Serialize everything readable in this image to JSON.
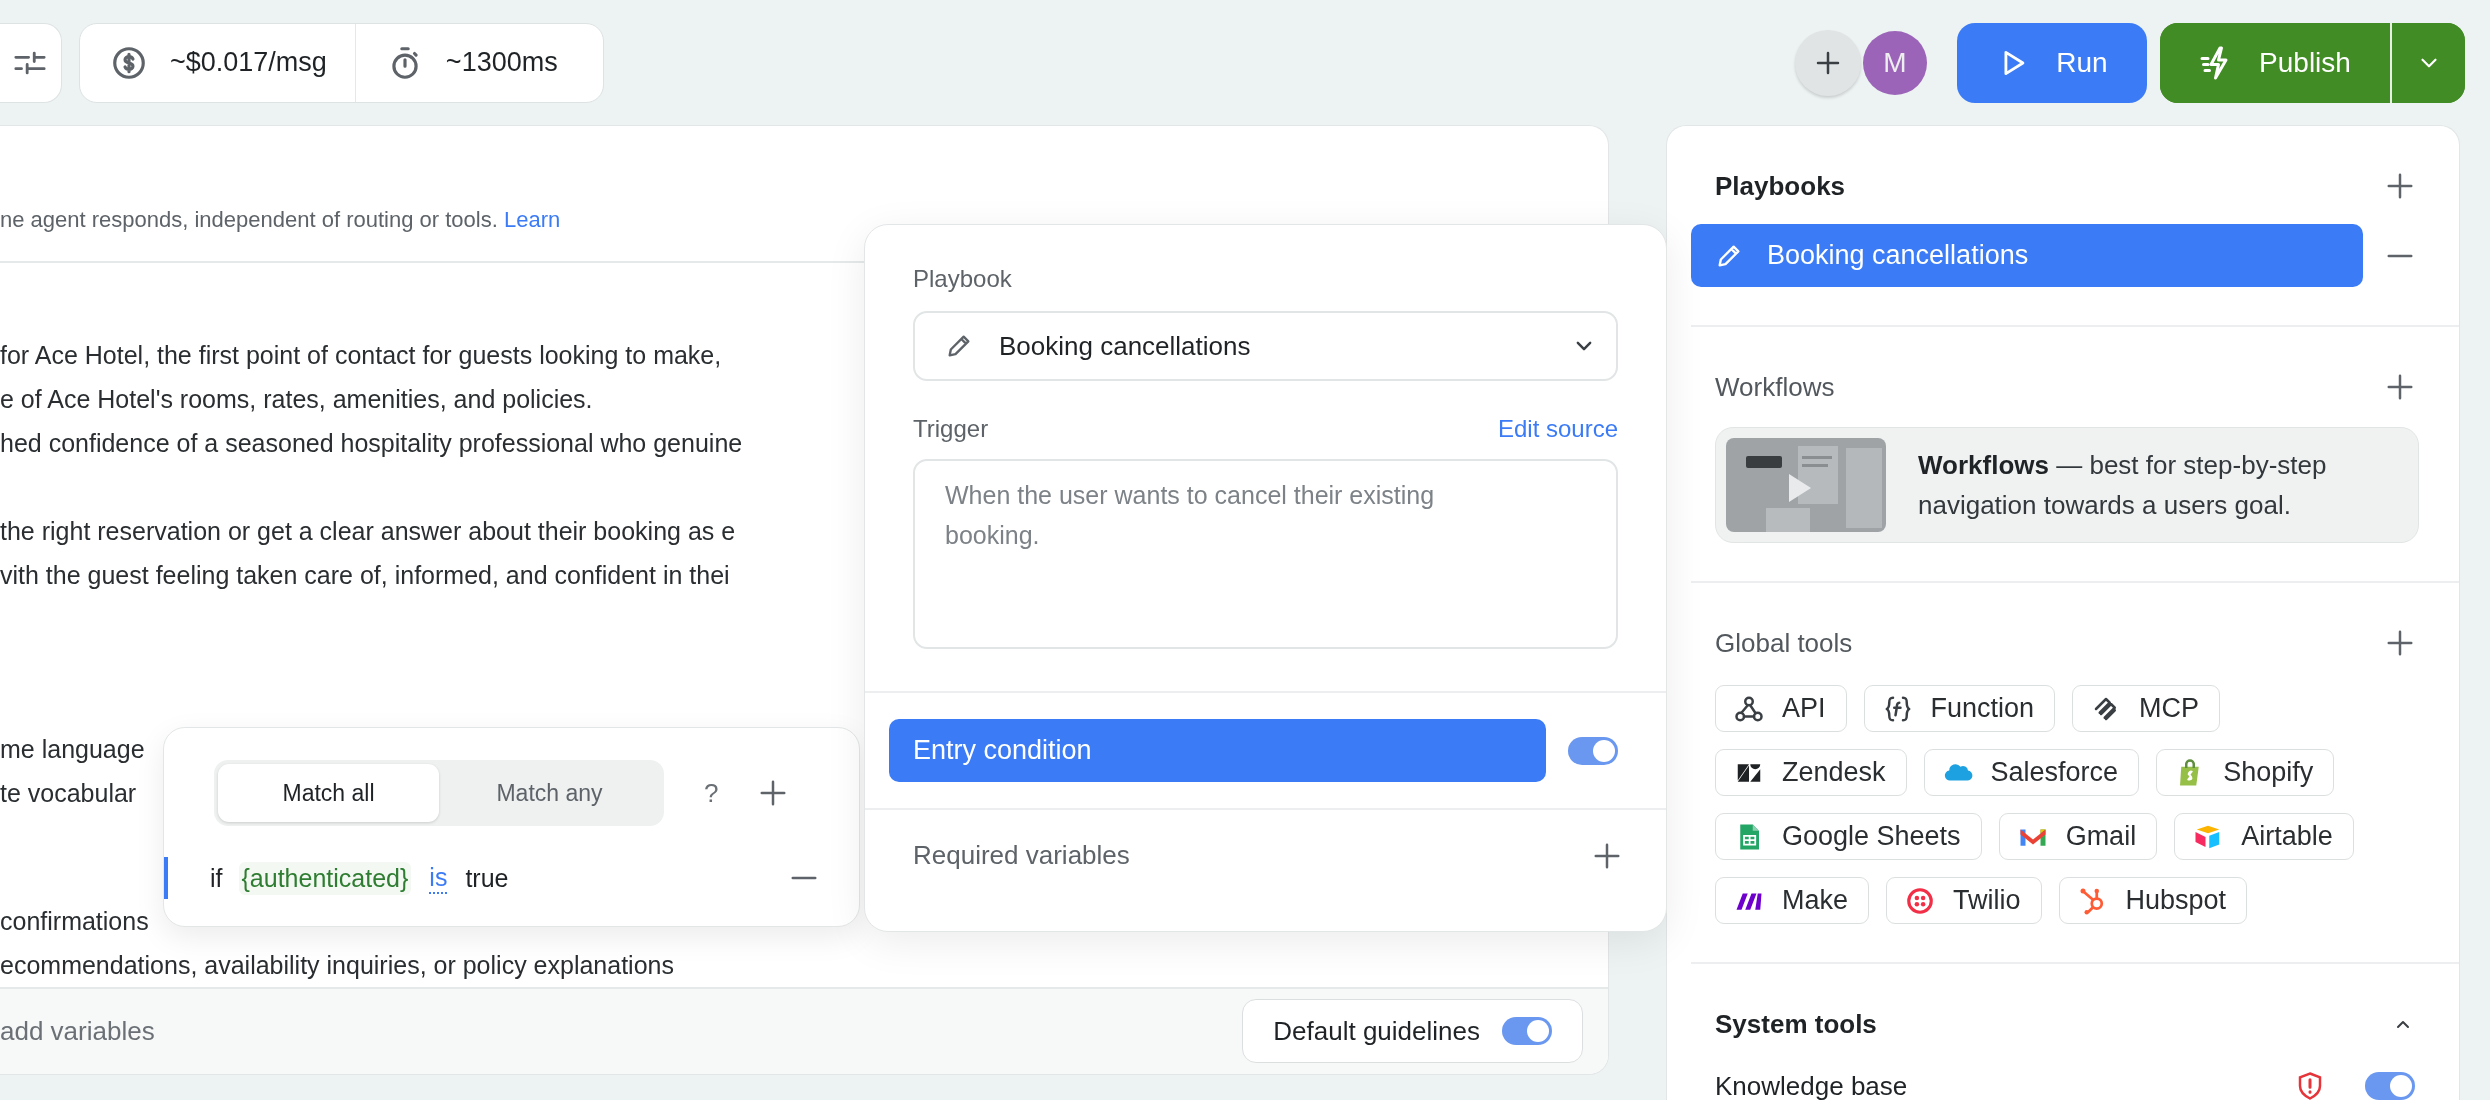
{
  "toolbar": {
    "cost": "~$0.017/msg",
    "latency": "~1300ms"
  },
  "header_actions": {
    "avatar_initial": "M",
    "run": "Run",
    "publish": "Publish"
  },
  "editor": {
    "description": "ne agent responds, independent of routing or tools. ",
    "learn_link": "Learn",
    "paragraphs": [
      [
        "for Ace Hotel, the first point of contact for guests looking to make,",
        "e of Ace Hotel's rooms, rates, amenities, and policies.",
        "hed confidence of a seasoned hospitality professional who genuine"
      ],
      [
        "the right reservation or get a clear answer about their booking as e",
        "vith the guest feeling taken care of, informed, and confident in thei"
      ],
      [
        "me language",
        "te vocabular"
      ],
      [
        "confirmations",
        "ecommendations, availability inquiries, or policy explanations"
      ]
    ],
    "footer_hint": "add variables",
    "default_guidelines": {
      "label": "Default guidelines",
      "on": true
    }
  },
  "condition_popover": {
    "modes": [
      {
        "label": "Match all",
        "selected": true
      },
      {
        "label": "Match any",
        "selected": false
      }
    ],
    "help": "?",
    "condition": {
      "prefix": "if",
      "variable": "{authenticated}",
      "operator": "is",
      "value": "true"
    }
  },
  "playbook_popover": {
    "playbook_label": "Playbook",
    "playbook_value": "Booking cancellations",
    "trigger_label": "Trigger",
    "edit_source": "Edit source",
    "trigger": {
      "placeholder": "When the user wants to cancel their existing booking."
    },
    "entry_condition": {
      "label": "Entry condition",
      "selected": true,
      "on": true
    },
    "required_variables": "Required variables"
  },
  "sidebar": {
    "playbooks": {
      "title": "Playbooks",
      "items": [
        {
          "label": "Booking cancellations",
          "selected": true
        }
      ]
    },
    "workflows": {
      "title": "Workflows",
      "promo": "**Workflows** — best for step-by-step navigation towards a users goal."
    },
    "global_tools": {
      "title": "Global tools",
      "items": [
        {
          "label": "API",
          "kind": "api"
        },
        {
          "label": "Function",
          "kind": "function"
        },
        {
          "label": "MCP",
          "kind": "mcp"
        },
        {
          "label": "Zendesk",
          "kind": "zendesk"
        },
        {
          "label": "Salesforce",
          "kind": "salesforce"
        },
        {
          "label": "Shopify",
          "kind": "shopify"
        },
        {
          "label": "Google Sheets",
          "kind": "sheets"
        },
        {
          "label": "Gmail",
          "kind": "gmail"
        },
        {
          "label": "Airtable",
          "kind": "airtable"
        },
        {
          "label": "Make",
          "kind": "make"
        },
        {
          "label": "Twilio",
          "kind": "twilio"
        },
        {
          "label": "Hubspot",
          "kind": "hubspot"
        }
      ]
    },
    "system_tools": {
      "title": "System tools",
      "expanded": true,
      "items": [
        {
          "label": "Knowledge base",
          "warning": true,
          "on": true
        }
      ]
    }
  }
}
